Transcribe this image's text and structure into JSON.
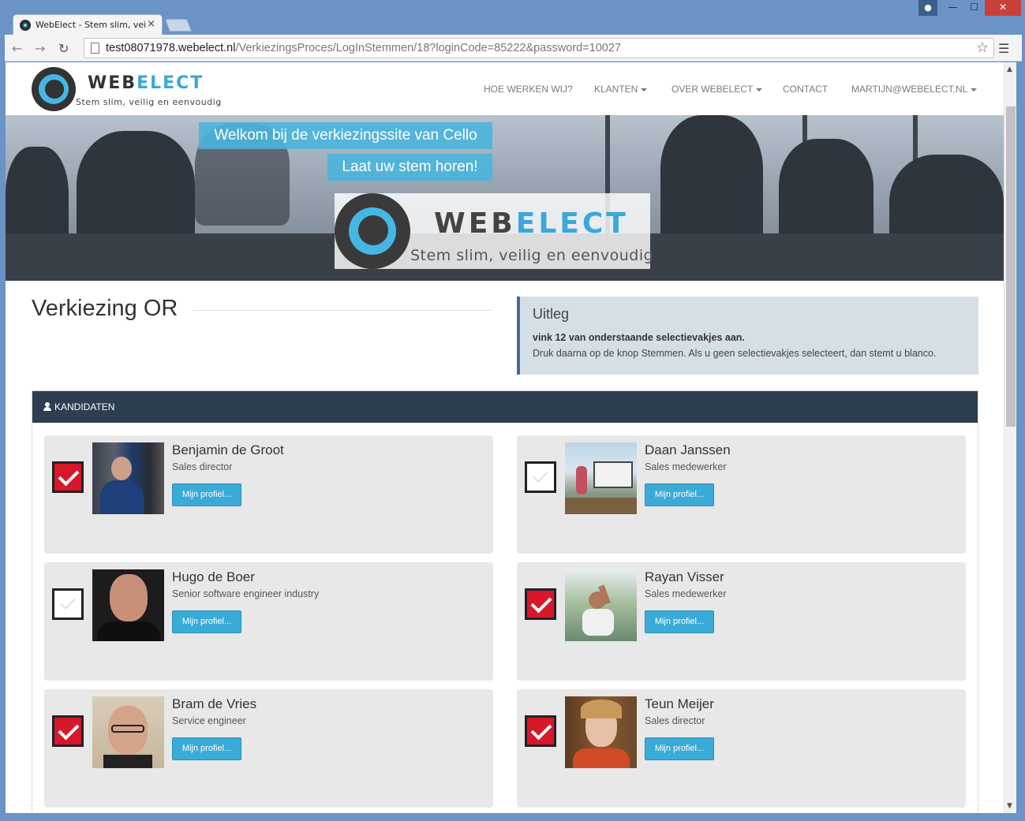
{
  "browser": {
    "tab_title": "WebElect - Stem slim, vei",
    "tab_close": "×",
    "url_host": "test08071978.webelect.nl",
    "url_path": "/VerkiezingsProces/LogInStemmen/18?loginCode=85222&password=10027",
    "window_buttons": {
      "minimize": "—",
      "maximize": "☐",
      "close": "✕"
    }
  },
  "header": {
    "logo_word_1": "WEB",
    "logo_word_2": "ELECT",
    "logo_tagline": "Stem slim, veilig en eenvoudig",
    "nav": [
      {
        "label": "HOE WERKEN WIJ?",
        "dropdown": false
      },
      {
        "label": "KLANTEN",
        "dropdown": true
      },
      {
        "label": "OVER WEBELECT",
        "dropdown": true
      },
      {
        "label": "CONTACT",
        "dropdown": false
      },
      {
        "label": "MARTIJN@WEBELECT.NL",
        "dropdown": true
      }
    ]
  },
  "hero": {
    "banner_1": "Welkom bij de verkiezingssite van Cello",
    "banner_2": "Laat uw stem horen!",
    "logo_word_1": "WEB",
    "logo_word_2": "ELECT",
    "logo_tagline": "Stem slim, veilig en eenvoudig"
  },
  "main": {
    "title": "Verkiezing OR",
    "uitleg": {
      "heading": "Uitleg",
      "line_1": "vink 12 van onderstaande selectievakjes aan.",
      "line_2": "Druk daarna op de knop Stemmen. Als u geen selectievakjes selecteert, dan stemt u blanco."
    },
    "panel_title": "KANDIDATEN",
    "profile_button": "Mijn profiel...",
    "candidates": [
      {
        "name": "Benjamin de Groot",
        "role": "Sales director",
        "checked": true
      },
      {
        "name": "Daan Janssen",
        "role": "Sales medewerker",
        "checked": false
      },
      {
        "name": "Hugo de Boer",
        "role": "Senior software engineer industry",
        "checked": false
      },
      {
        "name": "Rayan Visser",
        "role": "Sales medewerker",
        "checked": true
      },
      {
        "name": "Bram de Vries",
        "role": "Service engineer",
        "checked": true
      },
      {
        "name": "Teun Meijer",
        "role": "Sales director",
        "checked": true
      }
    ]
  },
  "colors": {
    "accent": "#3aabd6",
    "panel_header": "#2c3e50",
    "checked": "#d6182a",
    "uitleg_bg": "#d5e0e6"
  }
}
